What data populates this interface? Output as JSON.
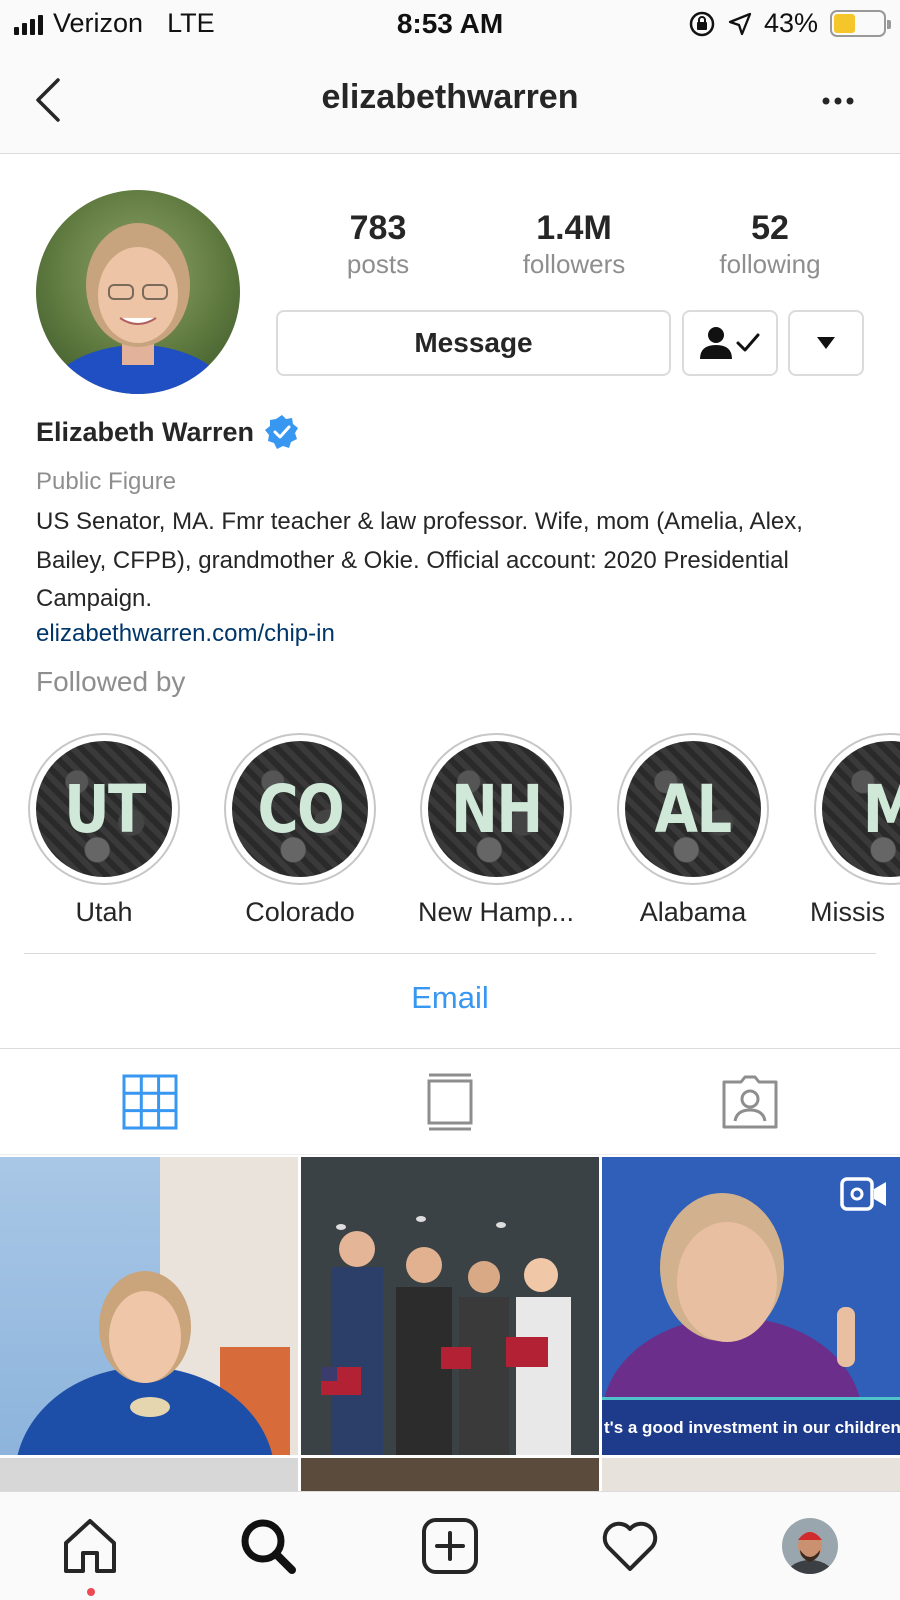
{
  "status_bar": {
    "carrier": "Verizon",
    "network": "LTE",
    "time": "8:53 AM",
    "battery_percent": "43%",
    "battery_level": 0.43,
    "icons": [
      "signal-bars-icon",
      "orientation-lock-icon",
      "location-arrow-icon",
      "battery-icon"
    ]
  },
  "nav": {
    "title": "elizabethwarren"
  },
  "profile": {
    "stats": [
      {
        "value": "783",
        "label": "posts"
      },
      {
        "value": "1.4M",
        "label": "followers"
      },
      {
        "value": "52",
        "label": "following"
      }
    ],
    "message_label": "Message",
    "name": "Elizabeth Warren",
    "verified": true,
    "category": "Public Figure",
    "bio": "US Senator, MA. Fmr teacher & law professor. Wife, mom (Amelia, Alex, Bailey, CFPB), grandmother & Okie. Official account: 2020 Presidential Campaign.",
    "link": "elizabethwarren.com/chip-in",
    "followed_by": "Followed by"
  },
  "highlights": [
    {
      "abbr": "UT",
      "label": "Utah"
    },
    {
      "abbr": "CO",
      "label": "Colorado"
    },
    {
      "abbr": "NH",
      "label": "New Hamp..."
    },
    {
      "abbr": "AL",
      "label": "Alabama"
    },
    {
      "abbr": "M",
      "label": "Missis"
    }
  ],
  "contact": {
    "email_label": "Email"
  },
  "tabs": [
    {
      "name": "grid",
      "active": true
    },
    {
      "name": "feed",
      "active": false
    },
    {
      "name": "tagged",
      "active": false
    }
  ],
  "grid": {
    "caption": "t's a good investment in our children."
  },
  "colors": {
    "accent": "#3897f0",
    "link": "#003569",
    "verified": "#3897f0",
    "notification_dot": "#ed4956",
    "battery": "#f5c629"
  },
  "bottom_nav": [
    "home-icon",
    "search-icon",
    "new-post-icon",
    "activity-heart-icon",
    "profile-avatar"
  ]
}
